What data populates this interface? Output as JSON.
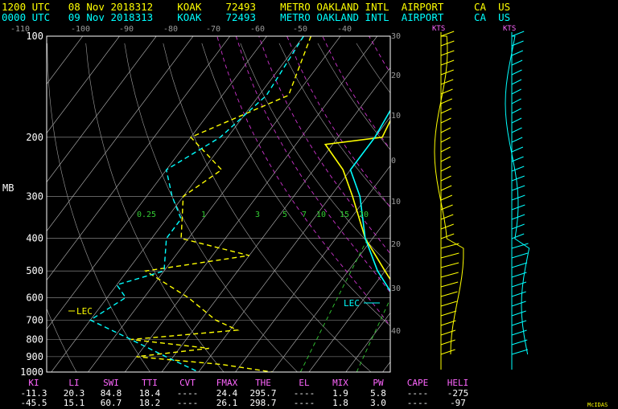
{
  "header": {
    "line1": "1200 UTC   08 Nov 2018312    KOAK    72493    METRO OAKLAND INTL  AIRPORT     CA  US",
    "line2": "0000 UTC   09 Nov 2018313    KOAK    72493    METRO OAKLAND INTL  AIRPORT     CA  US",
    "line1_color": "#ffff00",
    "line2_color": "#00ffff"
  },
  "chart_data": {
    "type": "line",
    "y_axis_label": "MB",
    "pressure_ticks": [
      "100",
      "200",
      "300",
      "400",
      "500",
      "600",
      "700",
      "800",
      "900",
      "1000"
    ],
    "temp_ticks": [
      "-110",
      "-100",
      "-90",
      "-80",
      "-70",
      "-60",
      "-50",
      "-40"
    ],
    "height_ticks_label": "KTS",
    "right_scale_ticks": [
      "30",
      "20",
      "10",
      "0",
      "10",
      "20",
      "30",
      "40"
    ],
    "mixing_ratio_labels": [
      "0.25",
      "1",
      "3",
      "5",
      "7",
      "10",
      "15",
      "20"
    ],
    "lec_label": "LEC",
    "soundings": [
      {
        "color": "#ffff00",
        "temperature": [
          [
            100,
            -60
          ],
          [
            150,
            -61
          ],
          [
            200,
            -58
          ],
          [
            210,
            -72
          ],
          [
            250,
            -62
          ],
          [
            300,
            -54
          ],
          [
            400,
            -42
          ],
          [
            500,
            -30
          ],
          [
            600,
            -20
          ],
          [
            700,
            -11
          ],
          [
            800,
            -3
          ],
          [
            850,
            1
          ],
          [
            900,
            5
          ],
          [
            950,
            9
          ],
          [
            1000,
            14
          ]
        ],
        "dewpoint": [
          [
            100,
            -98
          ],
          [
            150,
            -92
          ],
          [
            200,
            -110
          ],
          [
            250,
            -95
          ],
          [
            300,
            -100
          ],
          [
            400,
            -92
          ],
          [
            450,
            -70
          ],
          [
            500,
            -95
          ],
          [
            600,
            -78
          ],
          [
            700,
            -66
          ],
          [
            750,
            -58
          ],
          [
            800,
            -85
          ],
          [
            850,
            -62
          ],
          [
            900,
            -80
          ],
          [
            950,
            -55
          ],
          [
            1000,
            -40
          ]
        ]
      },
      {
        "color": "#00ffff",
        "temperature": [
          [
            100,
            -62
          ],
          [
            150,
            -62
          ],
          [
            200,
            -60
          ],
          [
            250,
            -60
          ],
          [
            300,
            -52
          ],
          [
            400,
            -42
          ],
          [
            500,
            -32
          ],
          [
            600,
            -22
          ],
          [
            700,
            -13
          ],
          [
            800,
            -4
          ],
          [
            850,
            0
          ],
          [
            900,
            4
          ],
          [
            950,
            9
          ],
          [
            1000,
            13
          ]
        ],
        "dewpoint": [
          [
            100,
            -100
          ],
          [
            150,
            -98
          ],
          [
            200,
            -102
          ],
          [
            250,
            -110
          ],
          [
            300,
            -103
          ],
          [
            350,
            -96
          ],
          [
            400,
            -96
          ],
          [
            500,
            -90
          ],
          [
            550,
            -100
          ],
          [
            600,
            -95
          ],
          [
            700,
            -100
          ],
          [
            800,
            -85
          ],
          [
            900,
            -72
          ],
          [
            1000,
            -60
          ]
        ]
      }
    ]
  },
  "indices": {
    "headers": [
      "KI",
      "LI",
      "SWI",
      "TTI",
      "CVT",
      "FMAX",
      "THE",
      "EL",
      "MIX",
      "PW",
      "CAPE",
      "HELI"
    ],
    "row1": [
      "-11.3",
      "20.3",
      "84.8",
      "18.4",
      "----",
      "24.4",
      "295.7",
      "----",
      "1.9",
      "5.8",
      "----",
      "-275"
    ],
    "row2": [
      "-45.5",
      "15.1",
      "60.7",
      "18.2",
      "----",
      "26.1",
      "298.7",
      "----",
      "1.8",
      "3.0",
      "----",
      "-97"
    ]
  },
  "footer": {
    "logo": "McIDAS"
  }
}
